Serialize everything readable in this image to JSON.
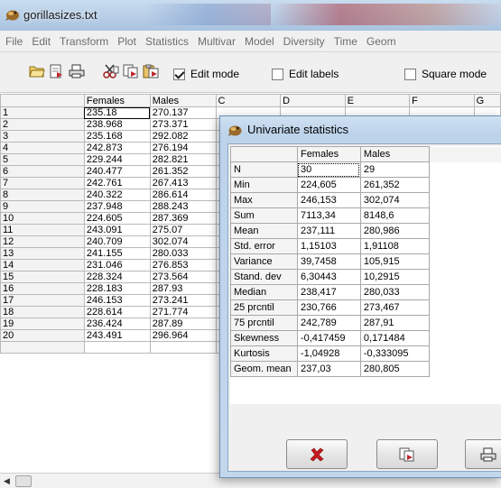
{
  "window": {
    "title": "gorillasizes.txt"
  },
  "menu": [
    "File",
    "Edit",
    "Transform",
    "Plot",
    "Statistics",
    "Multivar",
    "Model",
    "Diversity",
    "Time",
    "Geom"
  ],
  "toolbar": {
    "edit_mode_label": "Edit mode",
    "edit_mode_checked": true,
    "edit_labels_label": "Edit labels",
    "square_mode_label": "Square mode"
  },
  "grid": {
    "columns": [
      "",
      "Females",
      "Males",
      "C",
      "D",
      "E",
      "F",
      "G"
    ],
    "rows": [
      {
        "n": "1",
        "females": "235.18",
        "males": "270.137"
      },
      {
        "n": "2",
        "females": "238.968",
        "males": "273.371"
      },
      {
        "n": "3",
        "females": "235.168",
        "males": "292.082"
      },
      {
        "n": "4",
        "females": "242.873",
        "males": "276.194"
      },
      {
        "n": "5",
        "females": "229.244",
        "males": "282.821"
      },
      {
        "n": "6",
        "females": "240.477",
        "males": "261.352"
      },
      {
        "n": "7",
        "females": "242.761",
        "males": "267.413"
      },
      {
        "n": "8",
        "females": "240.322",
        "males": "286.614"
      },
      {
        "n": "9",
        "females": "237.948",
        "males": "288.243"
      },
      {
        "n": "10",
        "females": "224.605",
        "males": "287.369"
      },
      {
        "n": "11",
        "females": "243.091",
        "males": "275.07"
      },
      {
        "n": "12",
        "females": "240.709",
        "males": "302.074"
      },
      {
        "n": "13",
        "females": "241.155",
        "males": "280.033"
      },
      {
        "n": "14",
        "females": "231.046",
        "males": "276.853"
      },
      {
        "n": "15",
        "females": "228.324",
        "males": "273.564"
      },
      {
        "n": "16",
        "females": "228.183",
        "males": "287.93"
      },
      {
        "n": "17",
        "females": "246.153",
        "males": "273.241"
      },
      {
        "n": "18",
        "females": "228.614",
        "males": "271.774"
      },
      {
        "n": "19",
        "females": "236.424",
        "males": "287.89"
      },
      {
        "n": "20",
        "females": "243.491",
        "males": "296.964"
      }
    ]
  },
  "dialog": {
    "title": "Univariate statistics",
    "headers": [
      "",
      "Females",
      "Males"
    ],
    "rows": [
      {
        "label": "N",
        "females": "30",
        "males": "29"
      },
      {
        "label": "Min",
        "females": "224,605",
        "males": "261,352"
      },
      {
        "label": "Max",
        "females": "246,153",
        "males": "302,074"
      },
      {
        "label": "Sum",
        "females": "7113,34",
        "males": "8148,6"
      },
      {
        "label": "Mean",
        "females": "237,111",
        "males": "280,986"
      },
      {
        "label": "Std. error",
        "females": "1,15103",
        "males": "1,91108"
      },
      {
        "label": "Variance",
        "females": "39,7458",
        "males": "105,915"
      },
      {
        "label": "Stand. dev",
        "females": "6,30443",
        "males": "10,2915"
      },
      {
        "label": "Median",
        "females": "238,417",
        "males": "280,033"
      },
      {
        "label": "25 prcntil",
        "females": "230,766",
        "males": "273,467"
      },
      {
        "label": "75 prcntil",
        "females": "242,789",
        "males": "287,91"
      },
      {
        "label": "Skewness",
        "females": "-0,417459",
        "males": "0,171484"
      },
      {
        "label": "Kurtosis",
        "females": "-1,04928",
        "males": "-0,333095"
      },
      {
        "label": "Geom. mean",
        "females": "237,03",
        "males": "280,805"
      }
    ]
  }
}
